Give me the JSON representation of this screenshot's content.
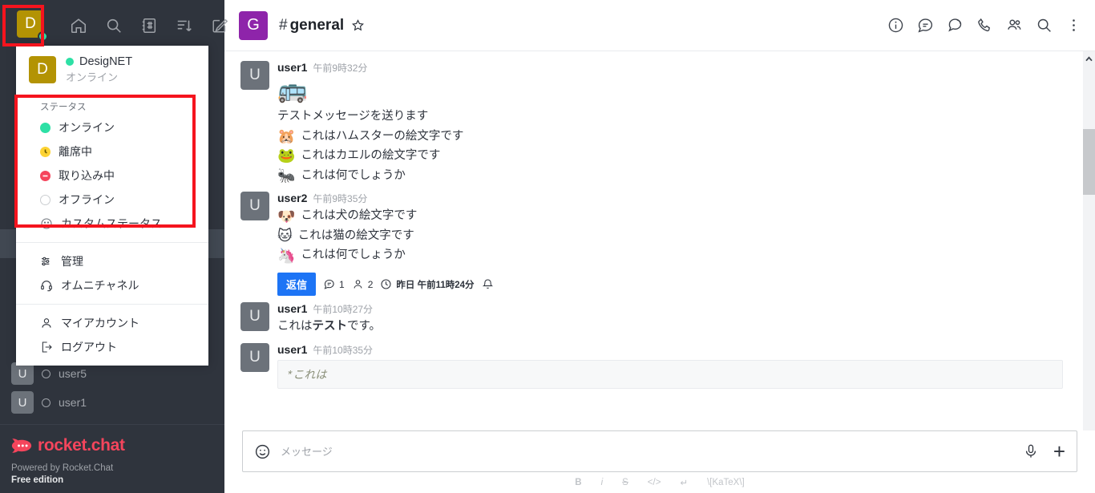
{
  "sidebar": {
    "workspace_avatar_letter": "D",
    "topbar_icons": [
      "home-icon",
      "search-icon",
      "directory-icon",
      "sort-icon",
      "create-new-icon"
    ],
    "rooms": [
      {
        "avatar_letter": "U",
        "name": "user5",
        "status": "offline"
      },
      {
        "avatar_letter": "U",
        "name": "user1",
        "status": "offline"
      }
    ],
    "footer": {
      "logo_text": "rocket.chat",
      "powered_by": "Powered by Rocket.Chat",
      "edition": "Free edition"
    }
  },
  "user_dropdown": {
    "avatar_letter": "D",
    "display_name": "DesigNET",
    "current_status": "オンライン",
    "status_section_title": "ステータス",
    "status_options": [
      {
        "label": "オンライン",
        "color": "#2de0a5",
        "icon": "status-online-icon"
      },
      {
        "label": "離席中",
        "color": "#fdd333",
        "icon": "status-away-icon"
      },
      {
        "label": "取り込み中",
        "color": "#f5455c",
        "icon": "status-busy-icon"
      },
      {
        "label": "オフライン",
        "color": "#cbced1",
        "icon": "status-offline-icon"
      },
      {
        "label": "カスタムステータス...",
        "color": "",
        "icon": "smile-icon"
      }
    ],
    "admin_items": [
      {
        "label": "管理",
        "icon": "customize-icon"
      },
      {
        "label": "オムニチャネル",
        "icon": "headphone-icon"
      }
    ],
    "account_items": [
      {
        "label": "マイアカウント",
        "icon": "user-icon"
      },
      {
        "label": "ログアウト",
        "icon": "sign-out-icon"
      }
    ]
  },
  "channel": {
    "avatar_letter": "G",
    "hash": "#",
    "name": "general",
    "favorite_icon": "star-icon",
    "header_actions": [
      "info-icon",
      "threads-icon",
      "discussions-icon",
      "phone-icon",
      "team-members-icon",
      "search-icon",
      "kebab-menu-icon"
    ]
  },
  "messages": [
    {
      "user": "user1",
      "time": "午前9時32分",
      "avatar_letter": "U",
      "big_emoji": "🚌",
      "lines": [
        {
          "emoji": "",
          "text": "テストメッセージを送ります"
        },
        {
          "emoji": "🐹",
          "text": "これはハムスターの絵文字です"
        },
        {
          "emoji": "🐸",
          "text": "これはカエルの絵文字です"
        },
        {
          "emoji": "🐜",
          "text": "これは何でしょうか"
        }
      ]
    },
    {
      "user": "user2",
      "time": "午前9時35分",
      "avatar_letter": "U",
      "lines": [
        {
          "emoji": "🐶",
          "text": "これは犬の絵文字です"
        },
        {
          "emoji": "🐱",
          "text": "これは猫の絵文字です"
        },
        {
          "emoji": "🦄",
          "text": "これは何でしょうか"
        }
      ],
      "thread": {
        "reply_label": "返信",
        "replies_count": "1",
        "participants_count": "2",
        "last_reply": "昨日 午前11時24分",
        "bell_icon": "bell-icon"
      }
    },
    {
      "user": "user1",
      "time": "午前10時27分",
      "avatar_letter": "U",
      "rich_text": {
        "prefix": "これは",
        "bold": "テスト",
        "suffix": "です。"
      }
    },
    {
      "user": "user1",
      "time": "午前10時35分",
      "avatar_letter": "U",
      "code_block": "*これは"
    }
  ],
  "composer": {
    "placeholder": "メッセージ",
    "emoji_icon": "emoji-icon",
    "audio_icon": "microphone-icon",
    "plus_icon": "plus-icon",
    "format_buttons": [
      {
        "label": "B",
        "name": "bold"
      },
      {
        "label": "i",
        "name": "italic"
      },
      {
        "label": "S",
        "name": "strike"
      },
      {
        "label": "</>",
        "name": "code"
      },
      {
        "label": "↵",
        "name": "multiline"
      },
      {
        "label": "\\[KaTeX\\]",
        "name": "katex"
      }
    ]
  },
  "colors": {
    "sidebar_bg": "#2f343d",
    "accent_blue": "#1d74f5",
    "brand_red": "#f5455c",
    "annotation_red": "#f5141e",
    "channel_avatar": "#8e24aa",
    "workspace_avatar": "#b39304",
    "online_green": "#2de0a5"
  }
}
